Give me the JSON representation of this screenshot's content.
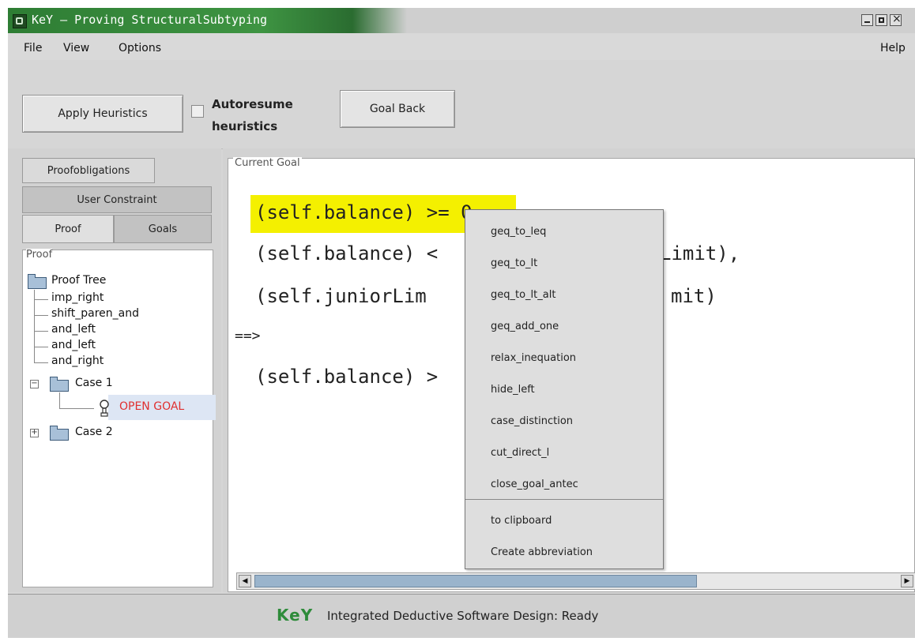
{
  "window": {
    "title": "KeY — Proving StructuralSubtyping"
  },
  "menu": {
    "file": "File",
    "view": "View",
    "options": "Options",
    "help": "Help"
  },
  "toolbar": {
    "apply_heuristics": "Apply Heuristics",
    "autoresume_line1": "Autoresume",
    "autoresume_line2": "heuristics",
    "autoresume_checked": false,
    "goal_back": "Goal Back"
  },
  "left_tabs": {
    "proofobligations": "Proofobligations",
    "user_constraint": "User Constraint",
    "proof": "Proof",
    "goals": "Goals"
  },
  "proof_panel": {
    "label": "Proof",
    "tree": {
      "root": "Proof Tree",
      "steps": [
        "imp_right",
        "shift_paren_and",
        "and_left",
        "and_left",
        "and_right"
      ],
      "case1": "Case 1",
      "open_goal": "OPEN GOAL",
      "case2": "Case 2"
    }
  },
  "goal_panel": {
    "label": "Current Goal",
    "lines": [
      "(self.balance) >= 0",
      "(self.balance) <",
      "Limit),",
      "(self.juniorLim",
      "mit)",
      "==>",
      "(self.balance) >"
    ]
  },
  "context_menu": {
    "items": [
      "geq_to_leq",
      "geq_to_lt",
      "geq_to_lt_alt",
      "geq_add_one",
      "relax_inequation",
      "hide_left",
      "case_distinction",
      "cut_direct_l",
      "close_goal_antec"
    ],
    "extra_items": [
      "to clipboard",
      "Create abbreviation"
    ]
  },
  "status": {
    "logo": "KeY",
    "text": "Integrated Deductive Software Design: Ready"
  },
  "colors": {
    "titlebar": "#2e7d34",
    "highlight": "#f4f000",
    "open_goal": "#e03030",
    "logo": "#2e8b3a"
  }
}
